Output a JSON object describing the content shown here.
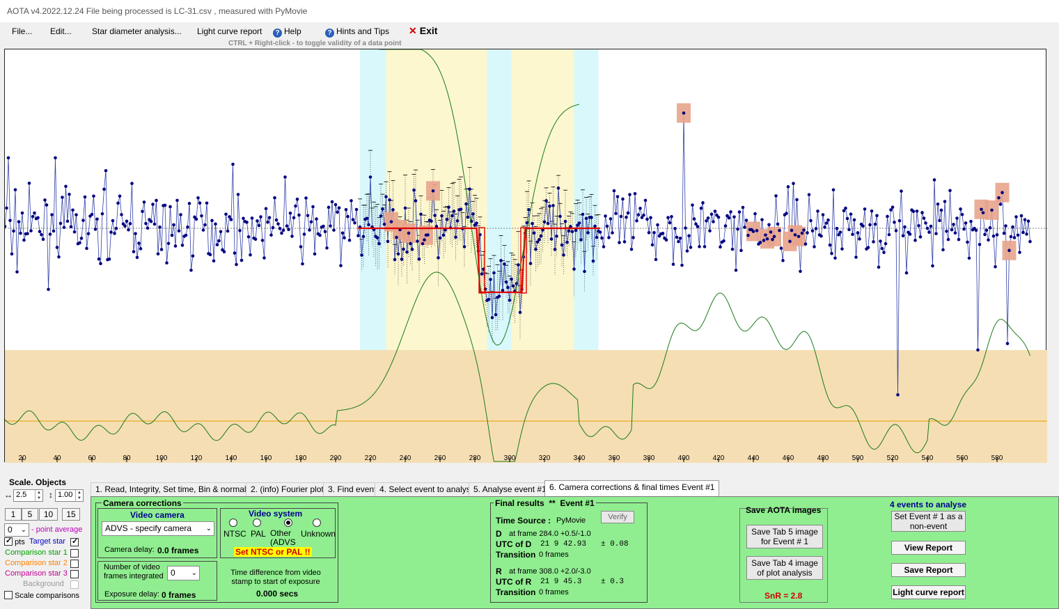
{
  "window": {
    "title": "AOTA v4.2022.12.24    File being processed is  LC-31.csv ,  measured with PyMovie"
  },
  "menu": {
    "file": "File...",
    "edit": "Edit...",
    "star_diameter": "Star diameter analysis...",
    "light_curve_report": "Light curve report",
    "help": "Help",
    "hints": "Hints and Tips",
    "exit": "Exit"
  },
  "hint_line": "CTRL + Right-click   -   to toggle validity of a data point",
  "chart_data": {
    "type": "scatter",
    "title": "",
    "xlabel": "",
    "ylabel": "",
    "xlim": [
      0,
      599
    ],
    "x_ticks": [
      20,
      40,
      60,
      80,
      100,
      120,
      140,
      160,
      180,
      200,
      220,
      240,
      260,
      280,
      300,
      320,
      340,
      360,
      380,
      400,
      420,
      440,
      460,
      480,
      500,
      520,
      540,
      560,
      580
    ],
    "y_relative_range": [
      -1.6,
      1.1
    ],
    "baseline_level": 1.0,
    "event_level": 0.0,
    "d_frame": 284,
    "r_frame": 308,
    "event_step": {
      "x": [
        213,
        281,
        282,
        283,
        284,
        307,
        308,
        309,
        352
      ],
      "y": [
        1.0,
        1.0,
        0.55,
        0.0,
        0.0,
        0.0,
        0.55,
        1.0,
        1.0
      ]
    },
    "regions": {
      "cyan_left": [
        214,
        229
      ],
      "yellow_d": [
        229,
        287
      ],
      "cyan_mid": [
        287,
        301
      ],
      "yellow_r": [
        301,
        337
      ],
      "cyan_right": [
        337,
        351
      ]
    },
    "marked_points": [
      232,
      237,
      242,
      252,
      256,
      400,
      440,
      448,
      452,
      461,
      464,
      466,
      571,
      577,
      583,
      587
    ]
  },
  "left_panel": {
    "scale_objects": "Scale.  Objects",
    "scale_value": "2.5",
    "objects_value": "1.00",
    "buttons": [
      "1",
      "5",
      "10",
      "15"
    ],
    "point_avg_value": "0",
    "point_avg_label": "- point average",
    "pts_label": "pts",
    "target_star": "Target star",
    "comp1": "Comparison star 1",
    "comp2": "Comparison star 2",
    "comp3": "Comparison star 3",
    "background": "Background",
    "scale_comparisons": "Scale comparisons",
    "colors": {
      "target": "#0000cc",
      "comp1": "#00a000",
      "comp2": "#ff8000",
      "comp3": "#c00090",
      "background": "#999999"
    }
  },
  "tabs": [
    "1.  Read, Integrity, Set time, Bin & normalise",
    "2. (info)  Fourier plot",
    "3. Find events",
    "4. Select event to analyse",
    "5. Analyse event #1",
    "6. Camera corrections & final times Event #1"
  ],
  "camera": {
    "group_title": "Camera corrections",
    "video_camera_title": "Video camera",
    "camera_value": "ADVS - specify camera",
    "camera_delay_label": "Camera delay:",
    "camera_delay_value": "0.0 frames",
    "video_system_title": "Video system",
    "radios": [
      "NTSC",
      "PAL",
      "Other\n(ADVS",
      "Unknown"
    ],
    "set_ntsc": "Set NTSC or PAL !!",
    "frames_integrated_label": "Number of video frames integrated",
    "frames_integrated_value": "0",
    "exposure_delay_label": "Exposure delay:",
    "exposure_delay_value": "0 frames",
    "time_diff_label": "Time difference from video stamp to start of exposure",
    "time_diff_value": "0.000 secs"
  },
  "results": {
    "title": "Final results",
    "stars": "**",
    "event": "Event #1",
    "time_source_label": "Time Source :",
    "time_source_value": "PyMovie",
    "verify": "Verify",
    "d_label": "D",
    "d_frame": "at frame 284.0  +0.5/-1.0",
    "utc_d_label": "UTC of D",
    "utc_d_value": "21   9  42.93",
    "utc_d_err": "± 0.08",
    "d_transition_label": "Transition",
    "d_transition_value": "0 frames",
    "r_label": "R",
    "r_frame": "at frame 308.0  +2.0/-3.0",
    "utc_r_label": "UTC of R",
    "utc_r_value": "21   9  45.3",
    "utc_r_err": "± 0.3",
    "r_transition_label": "Transition",
    "r_transition_value": "0 frames"
  },
  "save": {
    "title": "Save AOTA images",
    "tab5": "Save Tab 5 image for Event # 1",
    "tab4": "Save Tab 4 image of plot analysis",
    "snr": "SnR = 2.8"
  },
  "events": {
    "title": "4 events to analyse",
    "set_event": "Set Event # 1 as a non-event",
    "view_report": "View Report",
    "save_report": "Save Report",
    "lc_report": "Light curve report"
  }
}
